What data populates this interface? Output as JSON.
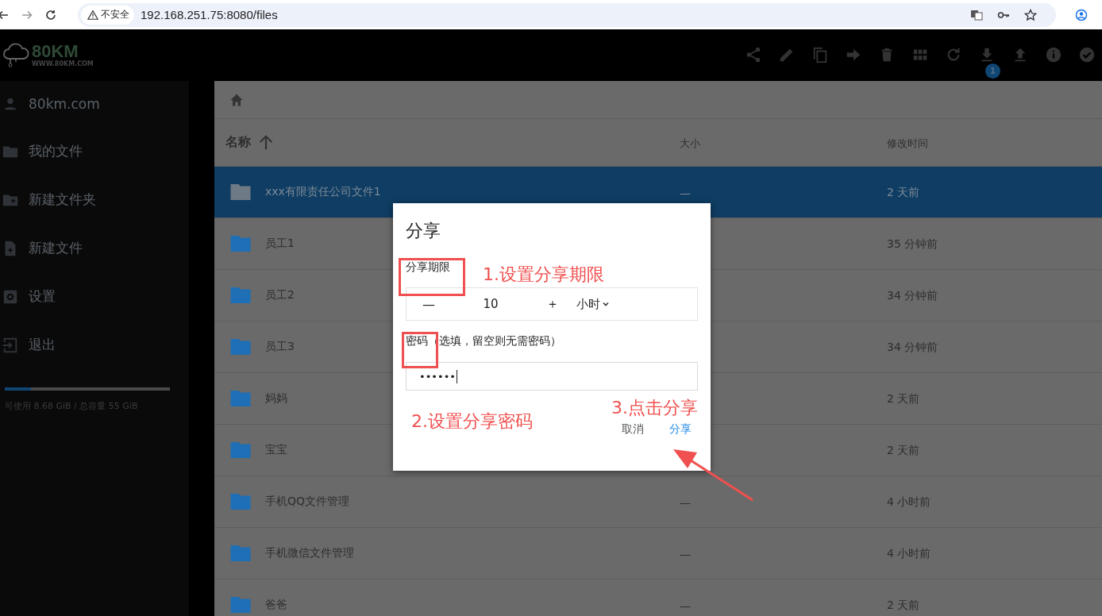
{
  "browser": {
    "security_label": "不安全",
    "url": "192.168.251.75:8080/files"
  },
  "header": {
    "logo_text": "80KM",
    "logo_subtext": "WWW.80KM.COM",
    "toolbar": [
      {
        "kind": "share"
      },
      {
        "kind": "edit"
      },
      {
        "kind": "copy"
      },
      {
        "kind": "move"
      },
      {
        "kind": "delete"
      },
      {
        "kind": "grid"
      },
      {
        "kind": "reload"
      },
      {
        "kind": "download",
        "badge": "1"
      },
      {
        "kind": "upload"
      },
      {
        "kind": "info"
      },
      {
        "kind": "check"
      }
    ]
  },
  "sidebar": {
    "items": [
      {
        "kind": "user",
        "label": "80km.com"
      },
      {
        "kind": "folder",
        "label": "我的文件"
      },
      {
        "kind": "new-folder",
        "label": "新建文件夹"
      },
      {
        "kind": "new-file",
        "label": "新建文件"
      },
      {
        "kind": "settings",
        "label": "设置"
      },
      {
        "kind": "logout",
        "label": "退出"
      }
    ],
    "storage": {
      "level": 0.16,
      "text": "可使用 8.68 GiB / 总容量 55 GiB"
    }
  },
  "table": {
    "columns": [
      "名称",
      "大小",
      "修改时间"
    ],
    "rows": [
      {
        "name": "xxx有限责任公司文件1",
        "size": "—",
        "modified": "2 天前",
        "selected": true
      },
      {
        "name": "员工1",
        "modified": "35 分钟前",
        "selected": false
      },
      {
        "name": "员工2",
        "modified": "34 分钟前",
        "selected": false
      },
      {
        "name": "员工3",
        "modified": "34 分钟前",
        "selected": false
      },
      {
        "name": "妈妈",
        "modified": "2 天前",
        "selected": false
      },
      {
        "name": "宝宝",
        "modified": "2 天前",
        "selected": false
      },
      {
        "name": "手机QQ文件管理",
        "size": "—",
        "modified": "4 小时前",
        "selected": false
      },
      {
        "name": "手机微信文件管理",
        "size": "—",
        "modified": "4 小时前",
        "selected": false
      },
      {
        "name": "爸爸",
        "size": "—",
        "modified": "2 天前",
        "selected": false
      }
    ]
  },
  "dialog": {
    "title": "分享",
    "expiry_label": "分享期限",
    "minus": "—",
    "amount": "10",
    "plus": "＋",
    "unit": "小时",
    "password_label": "密码",
    "password_hint": "（选填，留空则无需密码）",
    "password_value": "••••••",
    "buttons": [
      {
        "kind": "cancel",
        "label": "取消"
      },
      {
        "kind": "confirm",
        "label": "分享"
      }
    ]
  },
  "annotations": [
    {
      "text": "1.设置分享期限"
    },
    {
      "text": "2.设置分享密码"
    },
    {
      "text": "3.点击分享"
    }
  ]
}
